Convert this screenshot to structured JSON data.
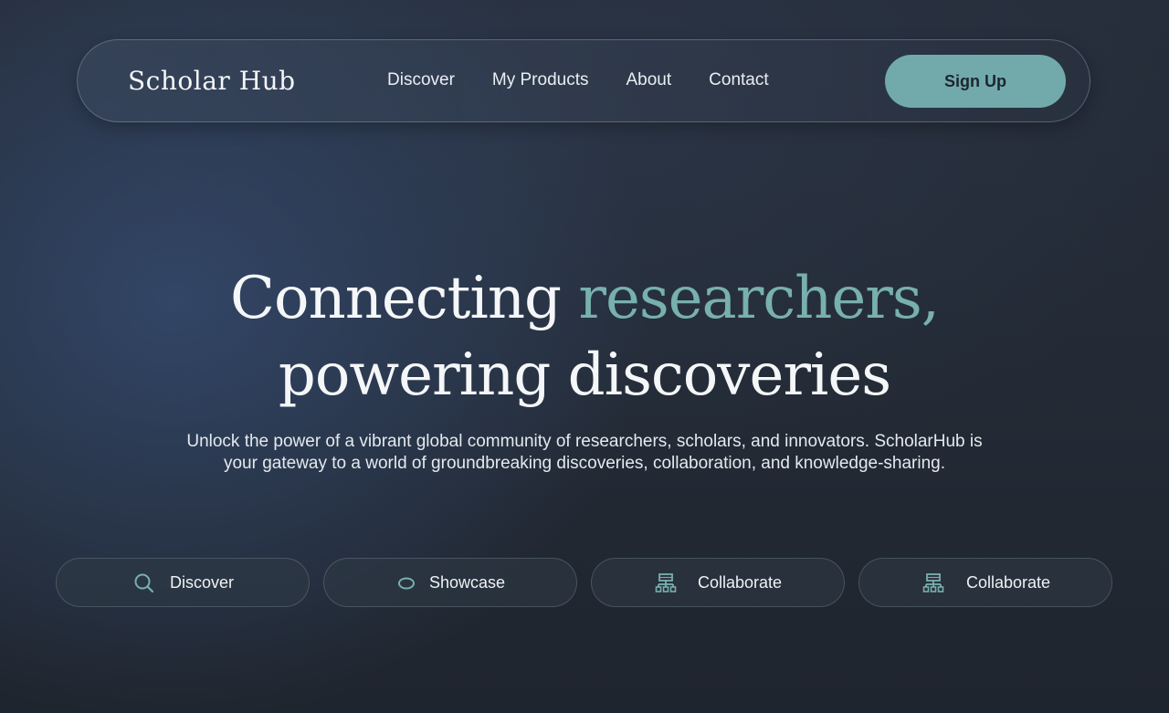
{
  "brand": "Scholar Hub",
  "nav": {
    "links": [
      "Discover",
      "My Products",
      "About",
      "Contact"
    ],
    "cta": "Sign Up"
  },
  "hero": {
    "title_start": "Connecting ",
    "title_accent": "researchers,",
    "title_end": "powering discoveries",
    "subtitle_line1": "Unlock the power of a vibrant global community of researchers, scholars,  and innovators. ScholarHub is",
    "subtitle_line2": "your gateway to a world of groundbreaking  discoveries, collaboration, and knowledge-sharing."
  },
  "features": [
    {
      "label": "Discover",
      "icon": "search-icon"
    },
    {
      "label": "Showcase",
      "icon": "eye-icon"
    },
    {
      "label": "Collaborate",
      "icon": "sitemap-icon"
    },
    {
      "label": "Collaborate",
      "icon": "sitemap-icon"
    }
  ],
  "colors": {
    "accent": "#78b0ae",
    "button": "#72aaab",
    "background": "#232a35"
  }
}
